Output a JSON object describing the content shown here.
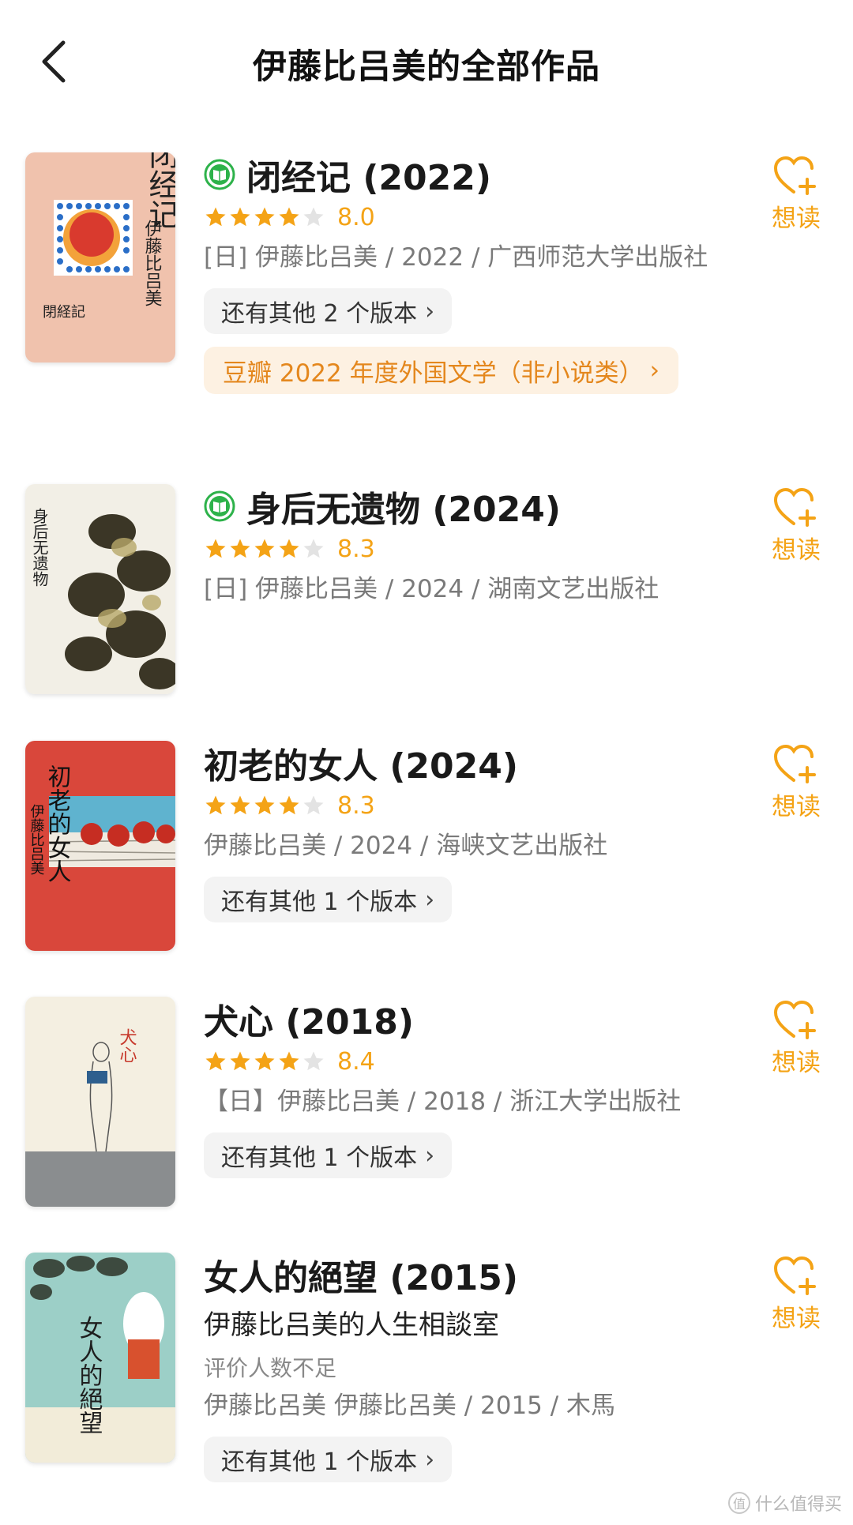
{
  "header": {
    "title": "伊藤比吕美的全部作品",
    "back_icon": "chevron-left-icon"
  },
  "colors": {
    "accent": "#f4a316",
    "read_badge": "#2db24a",
    "award_bg": "#fdf1e2",
    "award_text": "#e4871d",
    "meta_text": "#7a7a7a"
  },
  "want_label": "想读",
  "books": [
    {
      "title": "闭经记 (2022)",
      "has_read_badge": true,
      "rating_stars": 4,
      "score": "8.0",
      "meta": "[日] 伊藤比吕美 / 2022 / 广西师范大学出版社",
      "versions": "还有其他 2 个版本",
      "award": "豆瓣 2022 年度外国文学（非小说类）"
    },
    {
      "title": "身后无遗物 (2024)",
      "has_read_badge": true,
      "rating_stars": 4,
      "score": "8.3",
      "meta": "[日] 伊藤比吕美 / 2024 / 湖南文艺出版社"
    },
    {
      "title": "初老的女人 (2024)",
      "rating_stars": 4,
      "score": "8.3",
      "meta": "伊藤比吕美 / 2024 / 海峡文艺出版社",
      "versions": "还有其他 1 个版本"
    },
    {
      "title": "犬心 (2018)",
      "rating_stars": 4,
      "score": "8.4",
      "meta": "【日】伊藤比吕美 / 2018 / 浙江大学出版社",
      "versions": "还有其他 1 个版本"
    },
    {
      "title": "女人的絕望 (2015)",
      "subtitle": "伊藤比吕美的人生相談室",
      "no_rating": "评价人数不足",
      "meta": "伊藤比呂美 伊藤比呂美 / 2015 / 木馬",
      "versions": "还有其他 1 个版本"
    }
  ],
  "covers": {
    "b1": {
      "title": "闭经记",
      "author": "伊藤比吕美",
      "small": "閉経記"
    },
    "b2": {
      "title": "身后无遗物"
    },
    "b3": {
      "title": "初老的女人",
      "author": "伊藤比吕美"
    },
    "b4": {
      "title": "犬心"
    },
    "b5": {
      "title": "女人的絕望"
    }
  },
  "watermark": "什么值得买"
}
